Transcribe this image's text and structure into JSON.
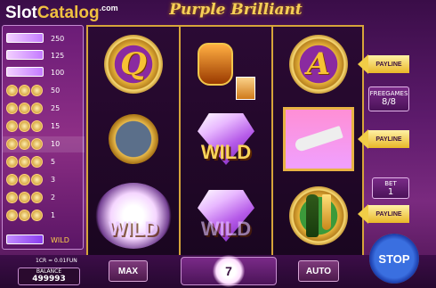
{
  "header": {
    "logo_part1": "Slot",
    "logo_part2": "Catalog",
    "logo_part3": ".com",
    "game_title": "Purple Brilliant"
  },
  "paytable": [
    {
      "symbol_icon": "purple-bar-icon",
      "value": "250"
    },
    {
      "symbol_icon": "purple-bar-icon",
      "value": "125"
    },
    {
      "symbol_icon": "purple-bar-icon",
      "value": "100"
    },
    {
      "symbol_icon": "coin-icon",
      "value": "50"
    },
    {
      "symbol_icon": "coin-icon",
      "value": "25"
    },
    {
      "symbol_icon": "coin-icon",
      "value": "15"
    },
    {
      "symbol_icon": "coin-icon",
      "value": "10"
    },
    {
      "symbol_icon": "coin-icon",
      "value": "5"
    },
    {
      "symbol_icon": "coin-icon",
      "value": "3"
    },
    {
      "symbol_icon": "coin-icon",
      "value": "2"
    },
    {
      "symbol_icon": "coin-icon",
      "value": "1"
    },
    {
      "symbol_icon": "wild-gem-icon",
      "value": "WILD"
    }
  ],
  "reels": {
    "reel1": [
      "Q",
      "watch",
      "wild-glow"
    ],
    "reel2": [
      "cognac",
      "WILD",
      "wild-glow"
    ],
    "reel3": [
      "A",
      "jet",
      "champagne"
    ],
    "wild_label": "WILD"
  },
  "right_panel": {
    "payline_label": "PAYLINE",
    "freegames_label": "FREEGAMES",
    "freegames_value": "8/8",
    "bet_label": "BET",
    "bet_value": "1"
  },
  "bottom": {
    "denomination": "1CR = 0.01FUN",
    "balance_label": "BALANCE",
    "balance_value": "499993",
    "max_label": "MAX",
    "win_value": "7",
    "auto_label": "AUTO",
    "stop_label": "STOP"
  },
  "colors": {
    "gold": "#d6a43a",
    "purple_bg": "#5c1a6b",
    "stop_blue": "#3a6fe0"
  }
}
